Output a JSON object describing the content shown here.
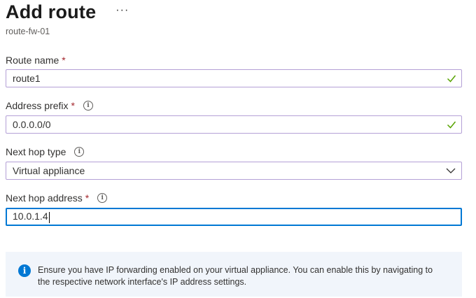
{
  "blade": {
    "title": "Add route",
    "more_label": "···",
    "subtitle": "route-fw-01"
  },
  "form": {
    "route_name": {
      "label": "Route name",
      "required_mark": "*",
      "value": "route1",
      "valid_icon": "checkmark-icon"
    },
    "address_prefix": {
      "label": "Address prefix",
      "required_mark": "*",
      "info_icon": "i",
      "value": "0.0.0.0/0",
      "valid_icon": "checkmark-icon"
    },
    "next_hop_type": {
      "label": "Next hop type",
      "info_icon": "i",
      "selected": "Virtual appliance",
      "dropdown_icon": "chevron-down-icon"
    },
    "next_hop_address": {
      "label": "Next hop address",
      "required_mark": "*",
      "info_icon": "i",
      "value": "10.0.1.4"
    }
  },
  "info_banner": {
    "icon": "i",
    "text_line1": "Ensure you have IP forwarding enabled on your virtual appliance. You can enable this by navigating to",
    "text_line2": "the respective network interface's IP address settings."
  },
  "colors": {
    "accent": "#0078d4",
    "valid_check": "#57a300",
    "required": "#a4262c",
    "banner_bg": "#f1f5fb"
  }
}
